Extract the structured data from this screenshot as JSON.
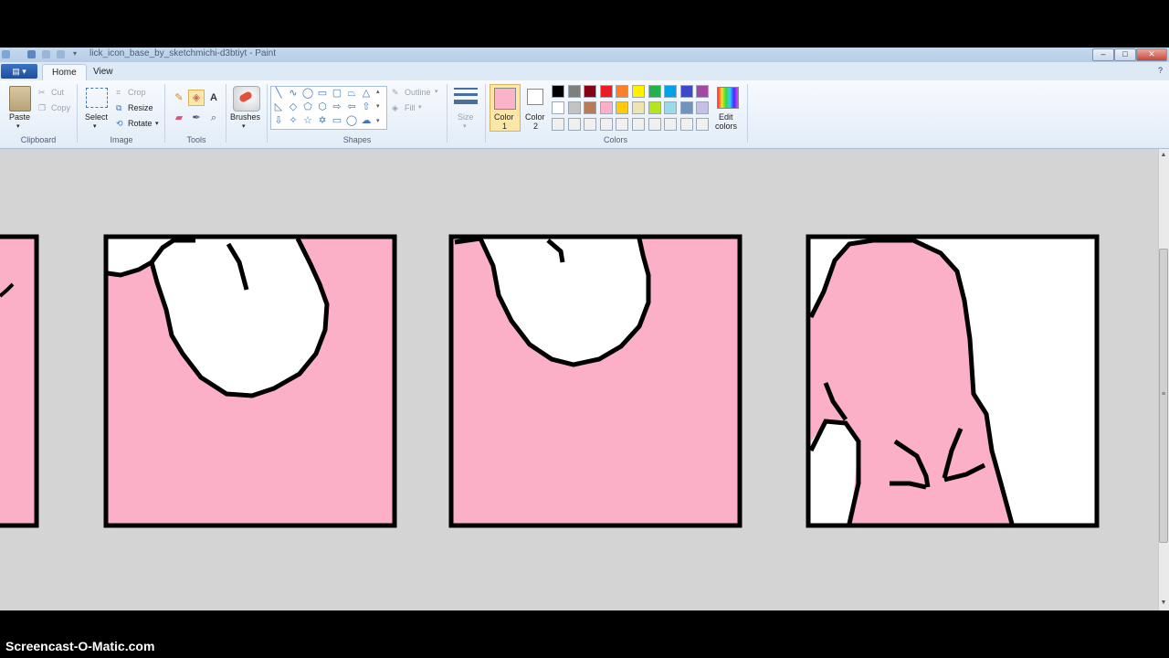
{
  "window": {
    "title": "lick_icon_base_by_sketchmichi-d3btiyt - Paint",
    "controls": {
      "minimize": "–",
      "maximize": "□",
      "close": "✕"
    }
  },
  "ribbon_tabs": {
    "app_menu": "▤ ▾",
    "home": "Home",
    "view": "View"
  },
  "clipboard": {
    "paste": "Paste",
    "cut": "Cut",
    "copy": "Copy",
    "group": "Clipboard"
  },
  "image": {
    "select": "Select",
    "crop": "Crop",
    "resize": "Resize",
    "rotate": "Rotate",
    "group": "Image"
  },
  "tools": {
    "group": "Tools"
  },
  "brushes": {
    "label": "Brushes"
  },
  "shapes": {
    "outline": "Outline",
    "fill": "Fill",
    "group": "Shapes"
  },
  "size": {
    "label": "Size"
  },
  "colors": {
    "color1": "Color",
    "color1_num": "1",
    "color2": "Color",
    "color2_num": "2",
    "edit": "Edit",
    "edit2": "colors",
    "group": "Colors",
    "color1_value": "#fab3c9",
    "color2_value": "#ffffff",
    "palette_row1": [
      "#000000",
      "#7f7f7f",
      "#880015",
      "#ed1c24",
      "#ff7f27",
      "#fff200",
      "#22b14c",
      "#00a2e8",
      "#3f48cc",
      "#a349a4"
    ],
    "palette_row2": [
      "#ffffff",
      "#c3c3c3",
      "#b97a57",
      "#ffaec9",
      "#ffc90e",
      "#efe4b0",
      "#b5e61d",
      "#99d9ea",
      "#7092be",
      "#c8bfe7"
    ],
    "palette_row3": [
      "#f0f0f0",
      "#f0f0f0",
      "#f0f0f0",
      "#f0f0f0",
      "#f0f0f0",
      "#f0f0f0",
      "#f0f0f0",
      "#f0f0f0",
      "#f0f0f0",
      "#f0f0f0"
    ]
  },
  "canvas": {
    "pink": "#fbb0c8",
    "outline": "#000000",
    "panel_count": 4
  },
  "watermark": "Screencast-O-Matic.com"
}
